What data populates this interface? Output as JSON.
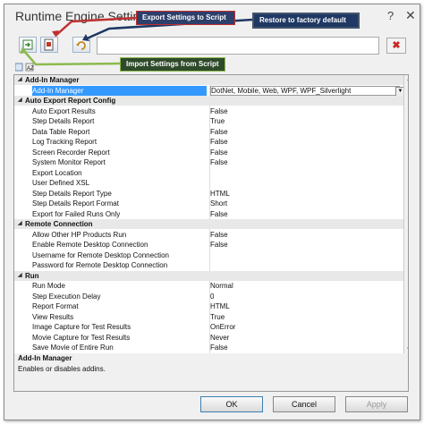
{
  "window": {
    "title": "Runtime Engine Settings",
    "help": "?",
    "close": "✕"
  },
  "toolbar": {
    "search_value": "",
    "clear_label": "✖"
  },
  "callouts": {
    "export": "Export Settings to Script",
    "restore": "Restore to factory default",
    "import": "Import Settings from Script"
  },
  "grid": {
    "rows": [
      {
        "kind": "cat",
        "label": "Add-In Manager"
      },
      {
        "kind": "prop",
        "name": "Add-In Manager",
        "value": "DotNet, Mobile, Web, WPF, WPF_Silverlight",
        "selected": true
      },
      {
        "kind": "cat",
        "label": "Auto Export Report Config"
      },
      {
        "kind": "prop",
        "name": "Auto Export Results",
        "value": "False"
      },
      {
        "kind": "prop",
        "name": "Step Details Report",
        "value": "True"
      },
      {
        "kind": "prop",
        "name": "Data Table Report",
        "value": "False"
      },
      {
        "kind": "prop",
        "name": "Log Tracking Report",
        "value": "False"
      },
      {
        "kind": "prop",
        "name": "Screen Recorder Report",
        "value": "False"
      },
      {
        "kind": "prop",
        "name": "System Monitor Report",
        "value": "False"
      },
      {
        "kind": "prop",
        "name": "Export Location",
        "value": ""
      },
      {
        "kind": "prop",
        "name": "User Defined XSL",
        "value": ""
      },
      {
        "kind": "prop",
        "name": "Step Details Report Type",
        "value": "HTML"
      },
      {
        "kind": "prop",
        "name": "Step Details Report Format",
        "value": "Short"
      },
      {
        "kind": "prop",
        "name": "Export for Failed Runs Only",
        "value": "False"
      },
      {
        "kind": "cat",
        "label": "Remote Connection"
      },
      {
        "kind": "prop",
        "name": "Allow Other HP Products Run",
        "value": "False"
      },
      {
        "kind": "prop",
        "name": "Enable Remote Desktop Connection",
        "value": "False"
      },
      {
        "kind": "prop",
        "name": "Username for Remote Desktop Connection",
        "value": ""
      },
      {
        "kind": "prop",
        "name": "Password for Remote Desktop Connection",
        "value": ""
      },
      {
        "kind": "cat",
        "label": "Run"
      },
      {
        "kind": "prop",
        "name": "Run Mode",
        "value": "Normal"
      },
      {
        "kind": "prop",
        "name": "Step Execution Delay",
        "value": "0"
      },
      {
        "kind": "prop",
        "name": "Report Format",
        "value": "HTML"
      },
      {
        "kind": "prop",
        "name": "View Results",
        "value": "True"
      },
      {
        "kind": "prop",
        "name": "Image Capture for Test Results",
        "value": "OnError"
      },
      {
        "kind": "prop",
        "name": "Movie Capture for Test Results",
        "value": "Never"
      },
      {
        "kind": "prop",
        "name": "Save Movie of Entire Run",
        "value": "False"
      }
    ]
  },
  "description": {
    "title": "Add-In Manager",
    "text": "Enables or disables addins."
  },
  "buttons": {
    "ok": "OK",
    "cancel": "Cancel",
    "apply": "Apply"
  },
  "colors": {
    "selection": "#3399ff",
    "callout_export_border": "#c03030",
    "callout_import_border": "#8dba4e",
    "callout_bg": "#1f3864"
  }
}
